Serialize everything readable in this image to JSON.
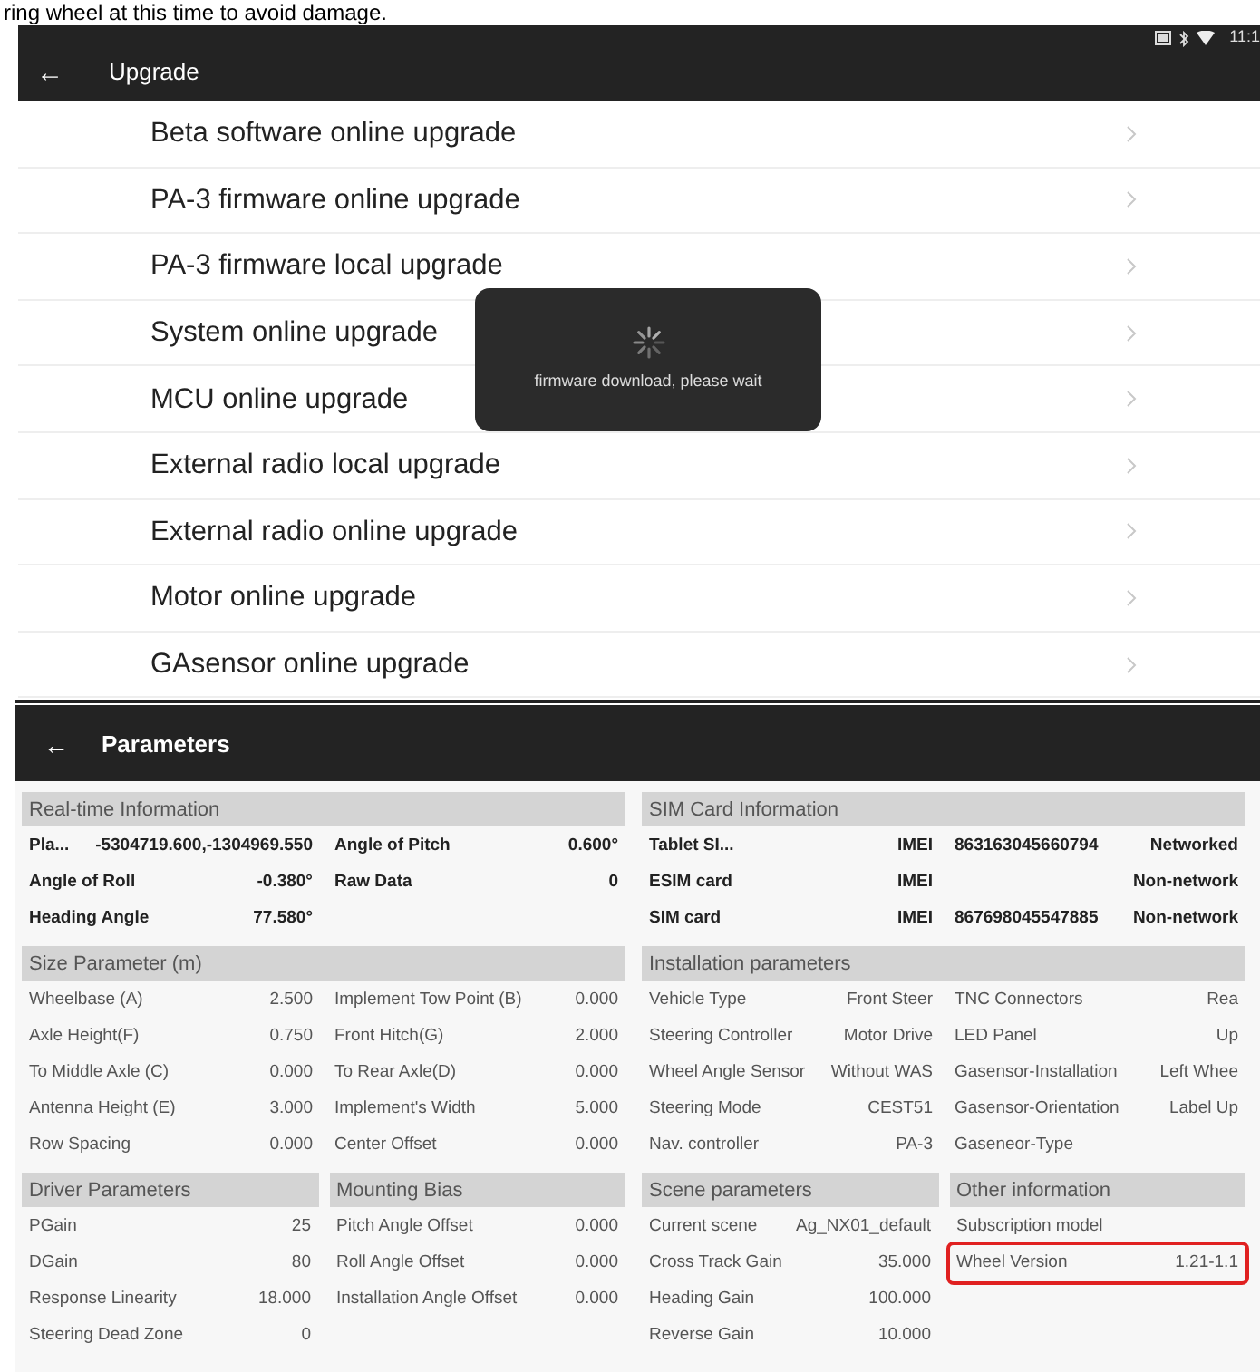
{
  "document_text": "ring wheel at this time to avoid damage.",
  "upgrade": {
    "status_time": "11:1",
    "title": "Upgrade",
    "back": "←",
    "items": [
      {
        "label": "Beta software online upgrade"
      },
      {
        "label": "PA-3 firmware online upgrade"
      },
      {
        "label": "PA-3 firmware local upgrade"
      },
      {
        "label": "System online upgrade"
      },
      {
        "label": "MCU online upgrade"
      },
      {
        "label": "External radio local upgrade"
      },
      {
        "label": "External radio online upgrade"
      },
      {
        "label": "Motor online upgrade"
      },
      {
        "label": "GAsensor online upgrade"
      }
    ],
    "dialog": {
      "message": "firmware download, please wait"
    }
  },
  "parameters": {
    "title": "Parameters",
    "back": "←",
    "columns": [
      {
        "blocks": [
          {
            "kind": "wide",
            "sections": [
              {
                "title": "Real-time Information",
                "kind": "info",
                "rows": [
                  {
                    "cells": [
                      "Pla...",
                      "-5304719.600,-1304969.550",
                      "Angle of Pitch",
                      "0.600°"
                    ],
                    "highlighted": false
                  },
                  {
                    "cells": [
                      "Angle of Roll",
                      "-0.380°",
                      "Raw Data",
                      "0"
                    ],
                    "highlighted": false
                  },
                  {
                    "cells": [
                      "Heading Angle",
                      "77.580°"
                    ],
                    "highlighted": false
                  }
                ]
              }
            ]
          },
          {
            "kind": "wide",
            "sections": [
              {
                "title": "Size Parameter (m)",
                "kind": "param",
                "rows": [
                  {
                    "cells": [
                      "Wheelbase (A)",
                      "2.500",
                      "Implement Tow Point (B)",
                      "0.000"
                    ],
                    "highlighted": false
                  },
                  {
                    "cells": [
                      "Axle Height(F)",
                      "0.750",
                      "Front Hitch(G)",
                      "2.000"
                    ],
                    "highlighted": false
                  },
                  {
                    "cells": [
                      "To Middle Axle (C)",
                      "0.000",
                      "To Rear Axle(D)",
                      "0.000"
                    ],
                    "highlighted": false
                  },
                  {
                    "cells": [
                      "Antenna Height (E)",
                      "3.000",
                      "Implement's Width",
                      "5.000"
                    ],
                    "highlighted": false
                  },
                  {
                    "cells": [
                      "Row Spacing",
                      "0.000",
                      "Center Offset",
                      "0.000"
                    ],
                    "highlighted": false
                  }
                ]
              }
            ]
          },
          {
            "kind": "split",
            "sections": [
              {
                "title": "Driver Parameters",
                "kind": "param",
                "rows": [
                  {
                    "cells": [
                      "PGain",
                      "25"
                    ],
                    "highlighted": false
                  },
                  {
                    "cells": [
                      "DGain",
                      "80"
                    ],
                    "highlighted": false
                  },
                  {
                    "cells": [
                      "Response Linearity",
                      "18.000"
                    ],
                    "highlighted": false
                  },
                  {
                    "cells": [
                      "Steering Dead Zone",
                      "0"
                    ],
                    "highlighted": false
                  }
                ]
              },
              {
                "title": "Mounting Bias",
                "kind": "param",
                "rows": [
                  {
                    "cells": [
                      "Pitch Angle Offset",
                      "0.000"
                    ],
                    "highlighted": false
                  },
                  {
                    "cells": [
                      "Roll Angle Offset",
                      "0.000"
                    ],
                    "highlighted": false
                  },
                  {
                    "cells": [
                      "Installation Angle Offset",
                      "0.000"
                    ],
                    "highlighted": false
                  }
                ]
              }
            ]
          }
        ]
      },
      {
        "blocks": [
          {
            "kind": "wide",
            "sections": [
              {
                "title": "SIM Card Information",
                "kind": "info",
                "rows": [
                  {
                    "cells": [
                      "Tablet SI...",
                      "IMEI",
                      "863163045660794",
                      "Networked"
                    ],
                    "highlighted": false
                  },
                  {
                    "cells": [
                      "ESIM card",
                      "IMEI",
                      "",
                      "Non-network"
                    ],
                    "highlighted": false
                  },
                  {
                    "cells": [
                      "SIM card",
                      "IMEI",
                      "867698045547885",
                      "Non-network"
                    ],
                    "highlighted": false
                  }
                ]
              }
            ]
          },
          {
            "kind": "wide",
            "sections": [
              {
                "title": "Installation parameters",
                "kind": "param",
                "rows": [
                  {
                    "cells": [
                      "Vehicle Type",
                      "Front Steer",
                      "TNC Connectors",
                      "Rea"
                    ],
                    "highlighted": false
                  },
                  {
                    "cells": [
                      "Steering Controller",
                      "Motor Drive",
                      "LED Panel",
                      "Up"
                    ],
                    "highlighted": false
                  },
                  {
                    "cells": [
                      "Wheel Angle Sensor",
                      "Without WAS",
                      "Gasensor-Installation",
                      "Left Whee"
                    ],
                    "highlighted": false
                  },
                  {
                    "cells": [
                      "Steering Mode",
                      "CEST51",
                      "Gasensor-Orientation",
                      "Label Up"
                    ],
                    "highlighted": false
                  },
                  {
                    "cells": [
                      "Nav. controller",
                      "PA-3",
                      "Gaseneor-Type"
                    ],
                    "highlighted": false
                  }
                ]
              }
            ]
          },
          {
            "kind": "split",
            "sections": [
              {
                "title": "Scene parameters",
                "kind": "param",
                "rows": [
                  {
                    "cells": [
                      "Current scene",
                      "Ag_NX01_default"
                    ],
                    "highlighted": false
                  },
                  {
                    "cells": [
                      "Cross Track Gain",
                      "35.000"
                    ],
                    "highlighted": false
                  },
                  {
                    "cells": [
                      "Heading Gain",
                      "100.000"
                    ],
                    "highlighted": false
                  },
                  {
                    "cells": [
                      "Reverse Gain",
                      "10.000"
                    ],
                    "highlighted": false
                  }
                ]
              },
              {
                "title": "Other information",
                "kind": "param",
                "rows": [
                  {
                    "cells": [
                      "Subscription model"
                    ],
                    "highlighted": false
                  },
                  {
                    "cells": [
                      "Wheel Version",
                      "1.21-1.1"
                    ],
                    "highlighted": true
                  }
                ]
              }
            ]
          }
        ]
      }
    ]
  }
}
